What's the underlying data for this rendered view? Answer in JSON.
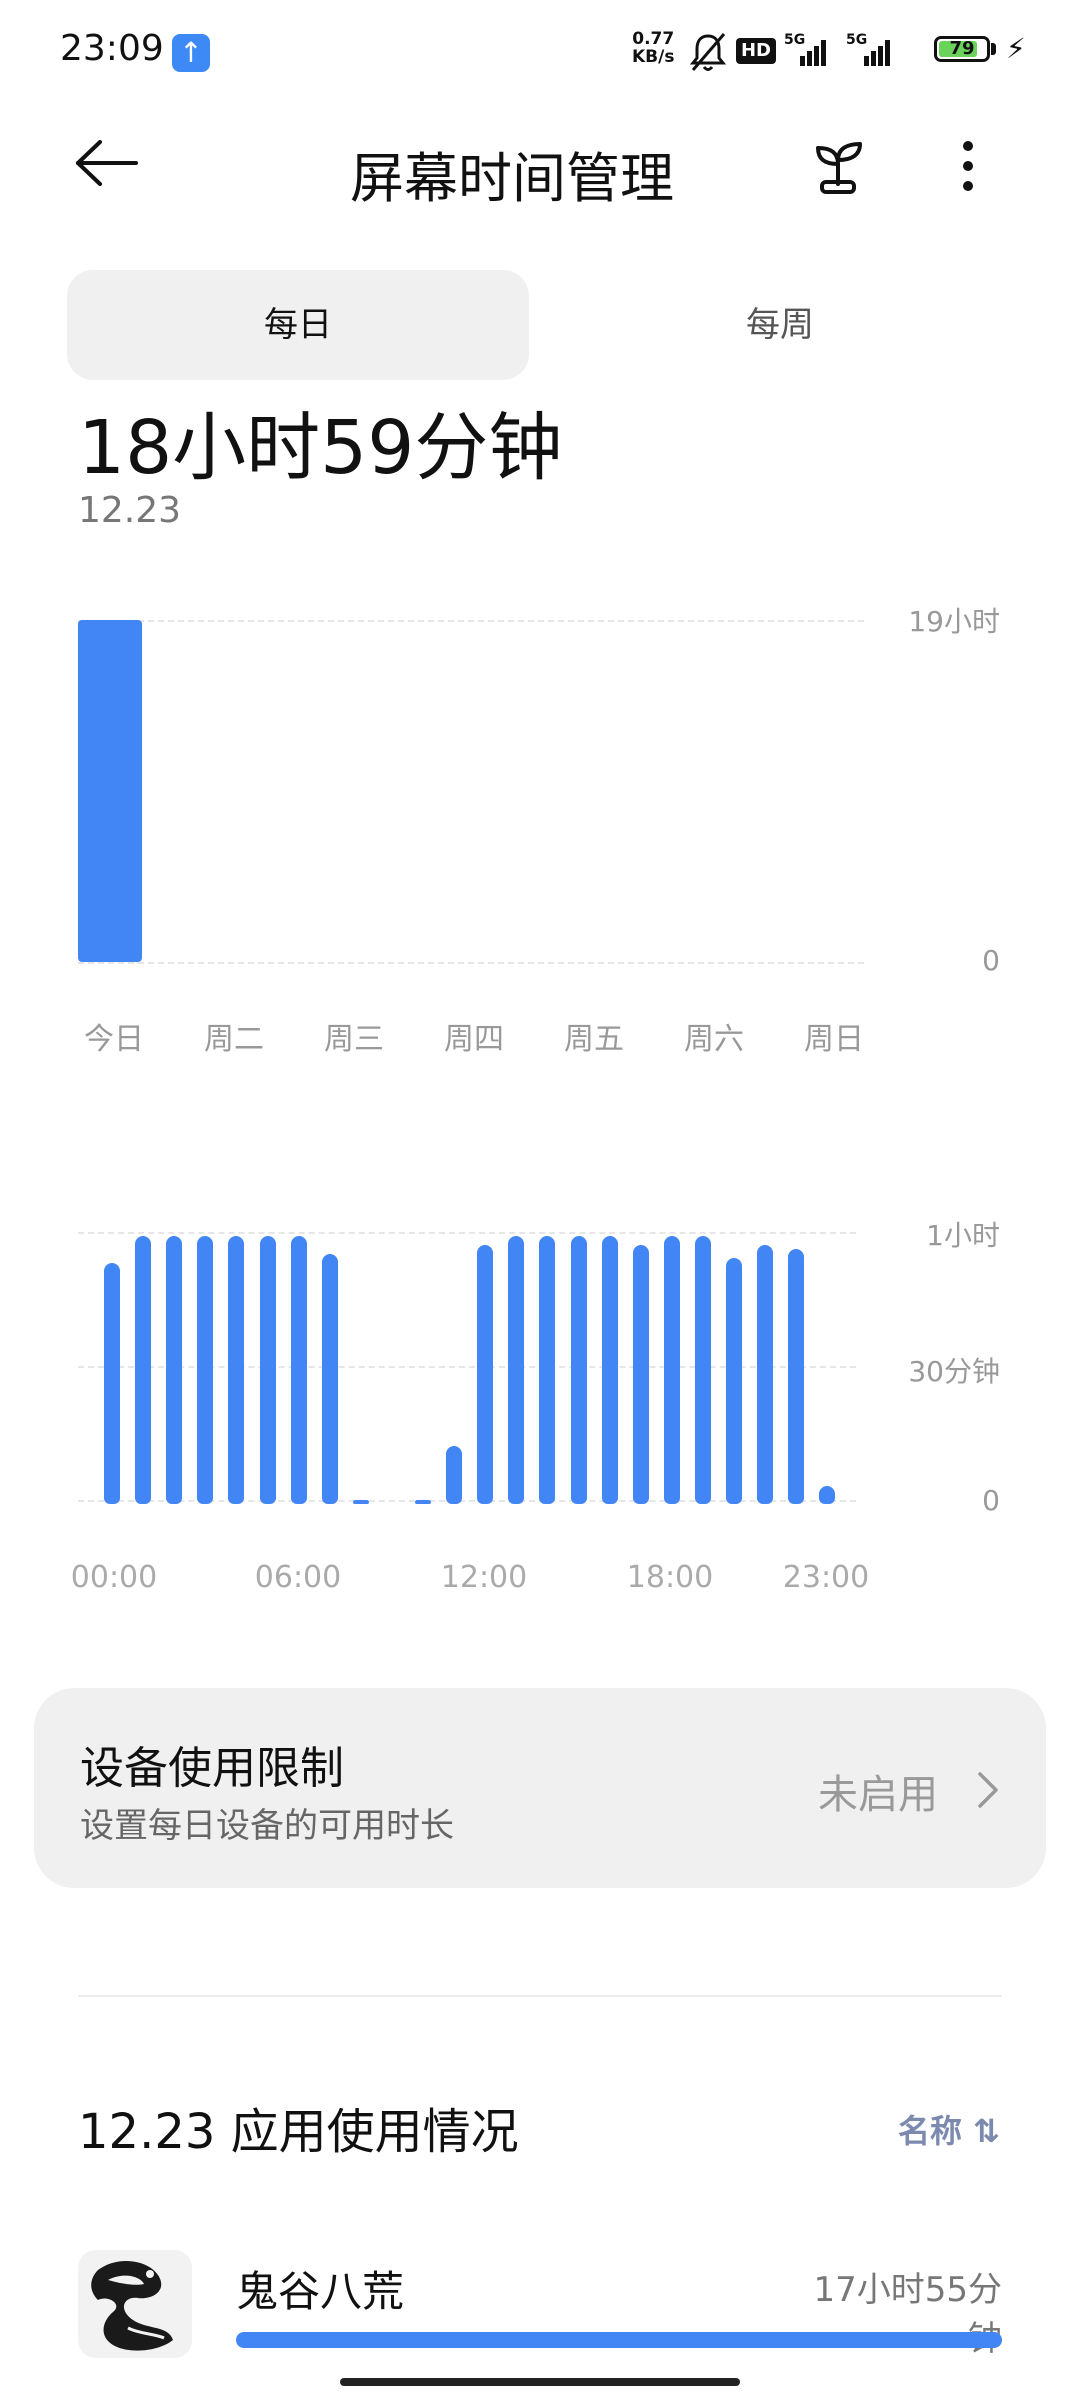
{
  "status_bar": {
    "time": "23:09",
    "upload_icon": "arrow-up-icon",
    "speed_value": "0.77",
    "speed_unit": "KB/s",
    "hd_label": "HD",
    "network_1": "5G",
    "network_2": "5G",
    "battery": "79",
    "colors": {
      "battery_fill": "#6bd35b",
      "upload_badge": "#3d8af7"
    }
  },
  "header": {
    "title": "屏幕时间管理",
    "back_icon": "arrow-left-icon",
    "plant_icon": "sprout-icon",
    "more_icon": "more-vertical-icon"
  },
  "tabs": [
    {
      "label": "每日",
      "active": true
    },
    {
      "label": "每周",
      "active": false
    }
  ],
  "summary": {
    "total": "18小时59分钟",
    "date": "12.23"
  },
  "chart_data": [
    {
      "type": "bar",
      "categories": [
        "今日",
        "周二",
        "周三",
        "周四",
        "周五",
        "周六",
        "周日"
      ],
      "values": [
        18.98,
        0,
        0,
        0,
        0,
        0,
        0
      ],
      "ylim": [
        0,
        19
      ],
      "y_tick_labels": [
        "19小时",
        "0"
      ],
      "highlight_category": "今日",
      "colors": {
        "bar": "#4285f4",
        "highlight": "#4285f4"
      }
    },
    {
      "type": "bar",
      "hours": [
        0,
        1,
        2,
        3,
        4,
        5,
        6,
        7,
        8,
        9,
        10,
        11,
        12,
        13,
        14,
        15,
        16,
        17,
        18,
        19,
        20,
        21,
        22,
        23
      ],
      "values": [
        54,
        60,
        60,
        60,
        60,
        60,
        60,
        56,
        1,
        0,
        0.5,
        13,
        58,
        60,
        60,
        60,
        60,
        58,
        60,
        60,
        55,
        58,
        57,
        4
      ],
      "ylim": [
        0,
        60
      ],
      "y_tick_labels": [
        "1小时",
        "30分钟",
        "0"
      ],
      "x_tick_labels": [
        "00:00",
        "06:00",
        "12:00",
        "18:00",
        "23:00"
      ],
      "unit": "minutes",
      "colors": {
        "bar": "#4285f4"
      }
    }
  ],
  "limit_card": {
    "title": "设备使用限制",
    "subtitle": "设置每日设备的可用时长",
    "status": "未启用",
    "chevron_icon": "chevron-right-icon"
  },
  "usage": {
    "title": "12.23 应用使用情况",
    "sort_label": "名称",
    "sort_icon": "sort-icon",
    "apps": [
      {
        "name": "鬼谷八荒",
        "time": "17小时55分钟",
        "fraction": 1.0
      }
    ]
  }
}
